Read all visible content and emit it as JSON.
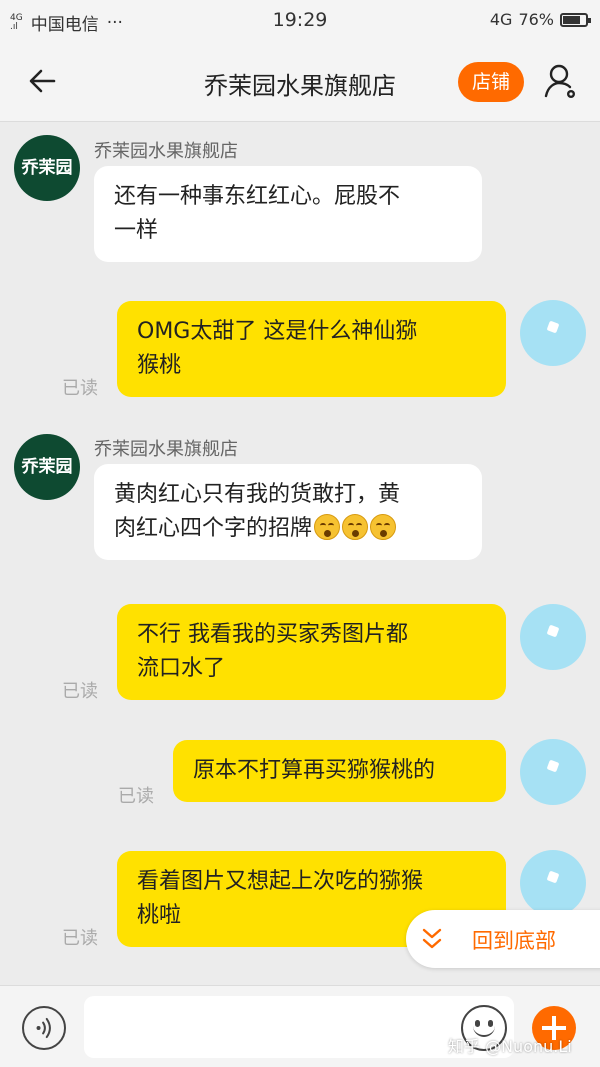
{
  "status_bar": {
    "signal_label": "4G",
    "carrier": "中国电信",
    "dots": "···",
    "time": "19:29",
    "network": "4G",
    "battery": "76%",
    "battery_level": 0.76
  },
  "nav": {
    "title": "乔茉园水果旗舰店",
    "shop_button": "店铺",
    "icons": [
      "back-arrow-icon",
      "user-settings-icon"
    ]
  },
  "shop_avatar_text": "乔茉园",
  "messages": [
    {
      "side": "in",
      "sender": "乔茉园水果旗舰店",
      "line1": "还有一种事东红红心。屁股不",
      "line2": "一样"
    },
    {
      "side": "out",
      "read": "已读",
      "line1": "OMG太甜了 这是什么神仙猕",
      "line2": "猴桃"
    },
    {
      "side": "in",
      "sender": "乔茉园水果旗舰店",
      "line1": "黄肉红心只有我的货敢打，黄",
      "line2": "肉红心四个字的招牌",
      "emojis": 3
    },
    {
      "side": "out",
      "read": "已读",
      "line1": "不行 我看我的买家秀图片都",
      "line2": "流口水了"
    },
    {
      "side": "out",
      "read": "已读",
      "line1": "原本不打算再买猕猴桃的"
    },
    {
      "side": "out",
      "read": "已读",
      "line1": "看着图片又想起上次吃的猕猴",
      "line2": "桃啦"
    }
  ],
  "scroll_to_bottom": {
    "label": "回到底部",
    "icon": "double-chevron-down-icon"
  },
  "input_bar": {
    "value": "",
    "icons": [
      "voice-icon",
      "emoji-icon",
      "plus-icon"
    ]
  },
  "watermark": "知乎 @Nuonu.Li",
  "colors": {
    "accent": "#ff6a00",
    "outgoing_bubble": "#ffe100",
    "shop_avatar": "#0e4a31",
    "user_avatar": "#a6e1f4"
  }
}
